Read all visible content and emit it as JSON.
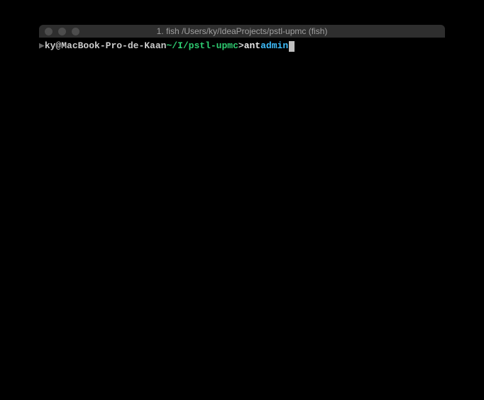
{
  "titlebar": {
    "title": "1. fish  /Users/ky/IdeaProjects/pstl-upmc (fish)"
  },
  "prompt": {
    "arrow": "▶",
    "user_host": "ky@MacBook-Pro-de-Kaan",
    "path": "~/I/pstl-upmc",
    "symbol": ">",
    "command": "ant",
    "arg": "admin"
  }
}
